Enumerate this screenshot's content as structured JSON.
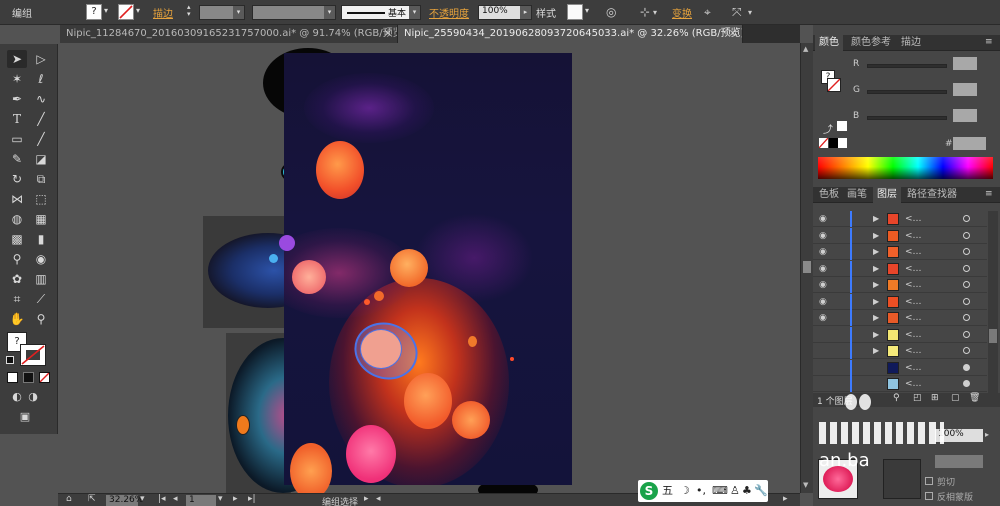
{
  "control_bar": {
    "group_label": "编组",
    "stroke_label": "描边",
    "stroke_profile": "基本",
    "opacity_label": "不透明度",
    "opacity_value": "100%",
    "style_label": "样式",
    "transform_label": "变换"
  },
  "tabs": [
    {
      "label": "Nipic_11284670_20160309165231757000.ai* @ 91.74% (RGB/预览)",
      "active": false
    },
    {
      "label": "Nipic_25590434_20190628093720645033.ai* @ 32.26% (RGB/预览)",
      "active": true
    }
  ],
  "status_bar": {
    "zoom": "32.26%",
    "page": "1",
    "selection": "编组选择"
  },
  "color_panel": {
    "tabs": [
      "颜色",
      "颜色参考",
      "描边"
    ],
    "channels": [
      "R",
      "G",
      "B"
    ],
    "hex_prefix": "#"
  },
  "layers_panel": {
    "tabs": [
      "色板",
      "画笔",
      "图层",
      "路径查找器"
    ],
    "layer_name": "<…",
    "rows": [
      {
        "visible": true,
        "expandable": true,
        "thumb_color": "#e8452a"
      },
      {
        "visible": true,
        "expandable": true,
        "thumb_color": "#ec5b23"
      },
      {
        "visible": true,
        "expandable": true,
        "thumb_color": "#f0602a"
      },
      {
        "visible": true,
        "expandable": true,
        "thumb_color": "#e8452a"
      },
      {
        "visible": true,
        "expandable": true,
        "thumb_color": "#f07a26"
      },
      {
        "visible": true,
        "expandable": true,
        "thumb_color": "#ec4f24"
      },
      {
        "visible": true,
        "expandable": true,
        "thumb_color": "#e85a28"
      },
      {
        "visible": false,
        "expandable": true,
        "thumb_color": "#f2e672"
      },
      {
        "visible": false,
        "expandable": true,
        "thumb_color": "#f5ea7a"
      },
      {
        "visible": false,
        "expandable": false,
        "thumb_color": "#101a5a"
      },
      {
        "visible": false,
        "expandable": false,
        "thumb_color": "#8fc4e0"
      }
    ],
    "footer": "1 个图层"
  },
  "transparency_panel": {
    "opacity_value": "100%",
    "clip_label": "剪切",
    "invert_label": "反相蒙版"
  },
  "ime": {
    "logo": "S",
    "mode": "五"
  },
  "watermark": "an.ba"
}
